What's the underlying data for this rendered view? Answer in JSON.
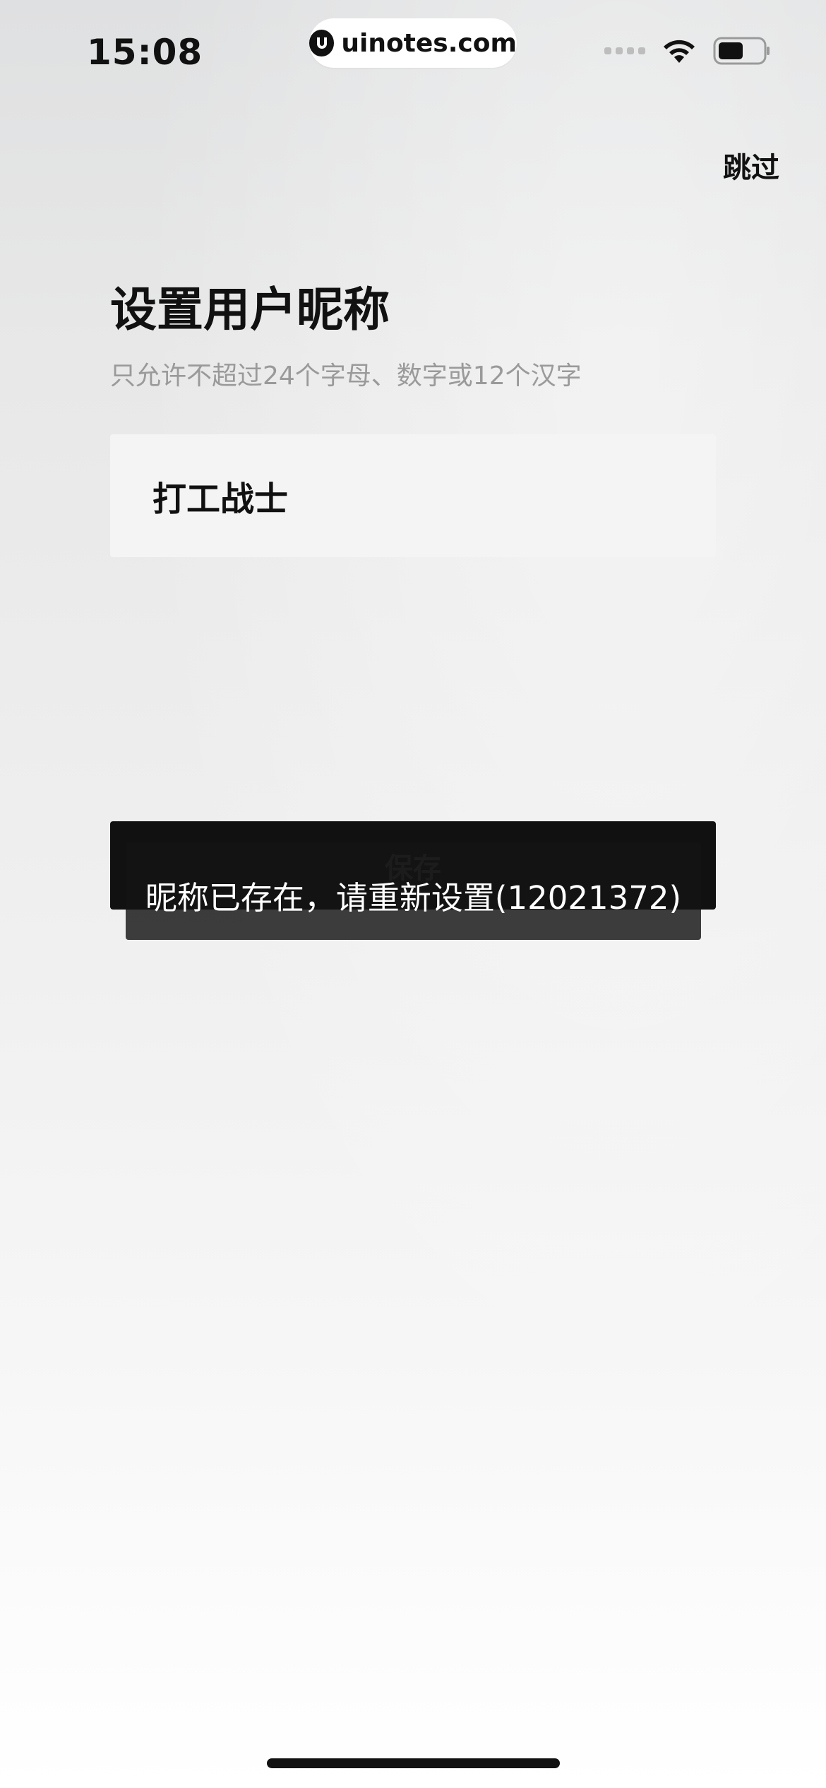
{
  "status_bar": {
    "time": "15:08",
    "brand": "uinotes.com"
  },
  "header": {
    "skip_label": "跳过"
  },
  "form": {
    "title": "设置用户昵称",
    "hint": "只允许不超过24个字母、数字或12个汉字",
    "nickname_value": "打工战士",
    "save_label": "保存"
  },
  "toast": {
    "message": "昵称已存在，请重新设置(12021372)"
  },
  "colors": {
    "button_bg": "#111111",
    "input_bg": "#f4f4f4",
    "hint_text": "#9a9a9a"
  },
  "icons": [
    "wifi-icon",
    "battery-icon",
    "signal-icon",
    "brand-logo-icon"
  ]
}
